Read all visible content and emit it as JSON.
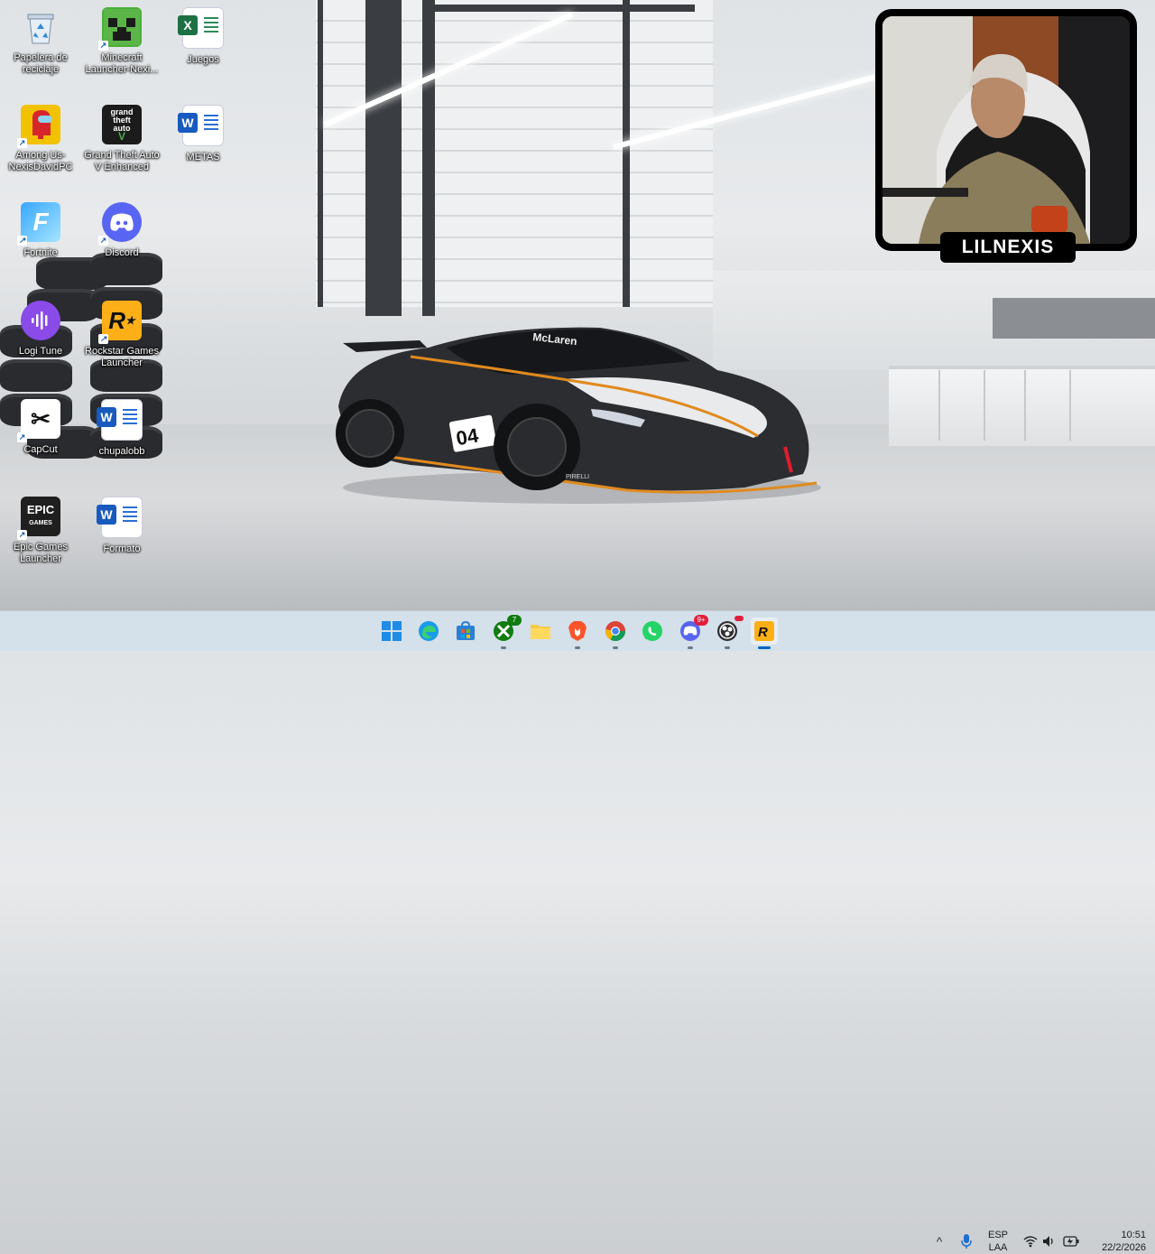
{
  "desktop": {
    "icons": [
      {
        "label": "Papelera de reciclaje",
        "icon": "recycle-bin-icon"
      },
      {
        "label": "Minecraft Launcher-Nexi...",
        "icon": "minecraft-icon"
      },
      {
        "label": "Juegos",
        "icon": "excel-icon"
      },
      {
        "label": "Among Us-NexisDavidPC",
        "icon": "among-us-icon"
      },
      {
        "label": "Grand Theft Auto V Enhanced",
        "icon": "gta-icon"
      },
      {
        "label": "METAS",
        "icon": "word-icon"
      },
      {
        "label": "Fortnite",
        "icon": "fortnite-icon"
      },
      {
        "label": "Discord",
        "icon": "discord-icon"
      },
      {
        "label": "Logi Tune",
        "icon": "logi-tune-icon"
      },
      {
        "label": "Rockstar Games Launcher",
        "icon": "rockstar-icon"
      },
      {
        "label": "CapCut",
        "icon": "capcut-icon"
      },
      {
        "label": "chupalobb",
        "icon": "word-icon"
      },
      {
        "label": "Epic Games Launcher",
        "icon": "epic-games-icon"
      },
      {
        "label": "Formato",
        "icon": "word-icon"
      }
    ]
  },
  "webcam": {
    "name_tag": "LILNEXIS"
  },
  "car": {
    "brand_text": "McLaren",
    "number": "04",
    "tire_text": "PIRELLI"
  },
  "taskbar": {
    "apps": [
      {
        "name": "Start",
        "icon": "windows-start-icon"
      },
      {
        "name": "Microsoft Edge",
        "icon": "edge-icon"
      },
      {
        "name": "Microsoft Store",
        "icon": "store-icon"
      },
      {
        "name": "Xbox",
        "icon": "xbox-icon",
        "badge": "7"
      },
      {
        "name": "File Explorer",
        "icon": "folder-icon"
      },
      {
        "name": "Brave",
        "icon": "brave-icon"
      },
      {
        "name": "Google Chrome",
        "icon": "chrome-icon"
      },
      {
        "name": "WhatsApp",
        "icon": "whatsapp-icon"
      },
      {
        "name": "Discord",
        "icon": "discord-icon",
        "badge": "9+"
      },
      {
        "name": "OBS Studio",
        "icon": "obs-icon"
      },
      {
        "name": "Rockstar Games Launcher",
        "icon": "rockstar-icon"
      }
    ],
    "tray": {
      "language_top": "ESP",
      "language_bottom": "LAA",
      "time": "10:51",
      "date": "22/2/2026"
    }
  },
  "colors": {
    "taskbar_bg": "#d4e0ea",
    "accent": "#0067c0"
  }
}
